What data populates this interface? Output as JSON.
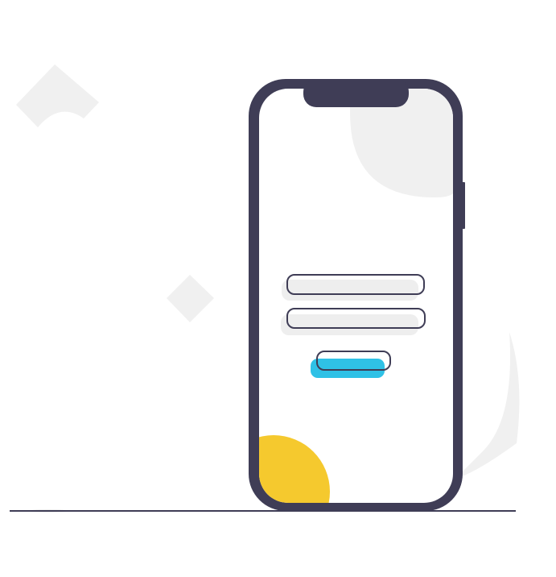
{
  "illustration": {
    "kind": "mobile-login-illustration",
    "colors": {
      "phone_frame": "#3f3d56",
      "screen": "#ffffff",
      "decor_gray": "#f0f0f0",
      "input_fill": "#eeeeee",
      "button_accent": "#2fc1e6",
      "corner_accent": "#f5c92e",
      "ground_line": "#3f3d56"
    },
    "login_form": {
      "fields": [
        {
          "name": "username",
          "value": ""
        },
        {
          "name": "password",
          "value": ""
        }
      ],
      "submit_label": ""
    }
  }
}
